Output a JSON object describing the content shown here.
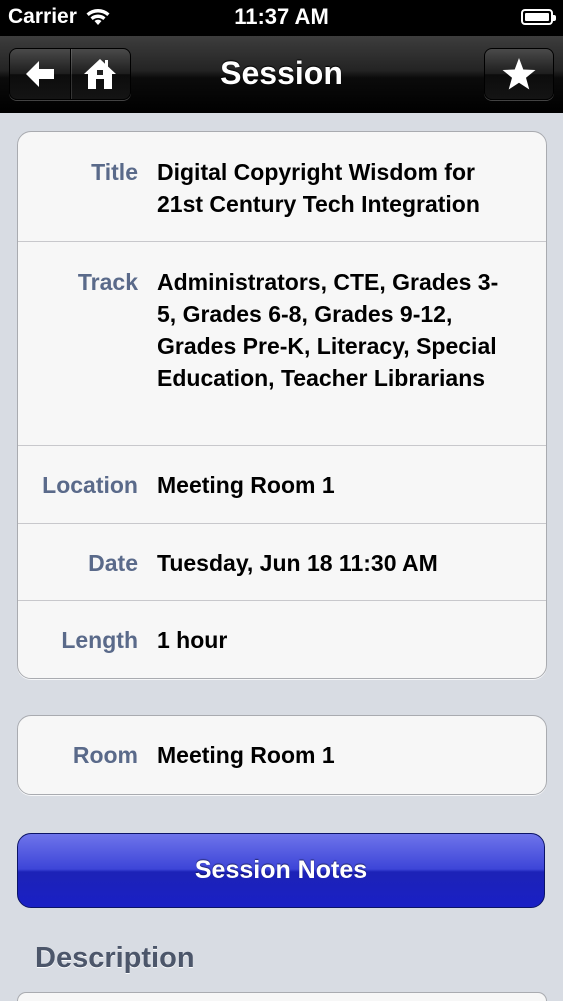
{
  "status_bar": {
    "carrier": "Carrier",
    "time": "11:37 AM",
    "battery_level": 1.0
  },
  "nav": {
    "title": "Session",
    "back_icon": "back-arrow-icon",
    "home_icon": "home-icon",
    "favorite_icon": "star-icon"
  },
  "details": [
    {
      "label": "Title",
      "value": "Digital Copyright Wisdom for 21st Century Tech Integration"
    },
    {
      "label": "Track",
      "value": "Administrators, CTE, Grades 3-5, Grades 6-8, Grades 9-12, Grades Pre-K, Literacy, Special Education, Teacher Librarians"
    },
    {
      "label": "Location",
      "value": "Meeting Room 1"
    },
    {
      "label": "Date",
      "value": "Tuesday, Jun 18 11:30 AM"
    },
    {
      "label": "Length",
      "value": "1 hour"
    }
  ],
  "room": {
    "label": "Room",
    "value": "Meeting Room 1"
  },
  "session_notes_label": "Session Notes",
  "description_heading": "Description",
  "colors": {
    "label": "#5a6a8a",
    "button": "#2a31d0",
    "background": "#d8dce3"
  }
}
